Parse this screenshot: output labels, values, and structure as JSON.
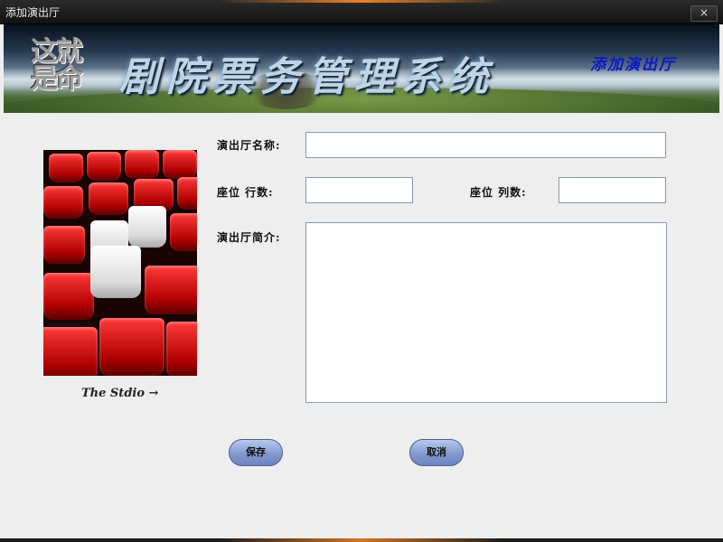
{
  "window": {
    "title": "添加演出厅",
    "close_label": "×"
  },
  "banner": {
    "logo_text": "这就是命",
    "title": "剧院票务管理系统",
    "subtitle": "添加演出厅"
  },
  "photo": {
    "caption": "The Stdio →"
  },
  "form": {
    "name_label": "演出厅名称:",
    "name_value": "",
    "rows_label": "座位 行数:",
    "rows_value": "",
    "cols_label": "座位 列数:",
    "cols_value": "",
    "desc_label": "演出厅简介:",
    "desc_value": ""
  },
  "buttons": {
    "save": "保存",
    "cancel": "取消"
  },
  "colors": {
    "button": "#7f96cc",
    "banner_subtitle": "#0c19c8",
    "titlebar": "#1a1a1a"
  }
}
